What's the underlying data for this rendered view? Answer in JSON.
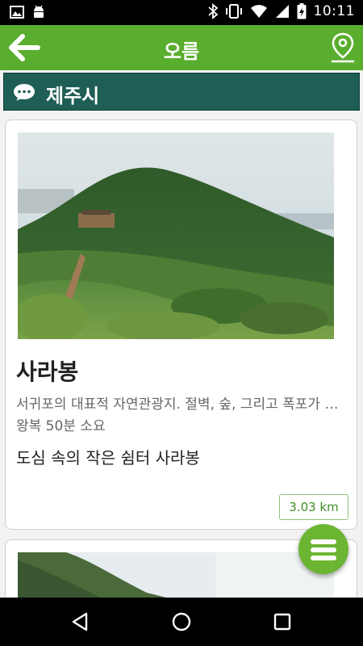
{
  "status_bar": {
    "time": "10:11",
    "icons": [
      "image-icon",
      "android-icon",
      "bluetooth-icon",
      "vibrate-icon",
      "wifi-icon",
      "signal-icon",
      "battery-charging-icon"
    ]
  },
  "app_bar": {
    "title": "오름",
    "back_icon": "arrow-left-icon",
    "map_icon": "map-pin-icon",
    "color": "#5aae2e"
  },
  "section": {
    "label": "제주시",
    "icon": "chat-bubble-icon",
    "color": "#1e5e55"
  },
  "cards": [
    {
      "name": "사라봉",
      "description": "서귀포의 대표적 자연관광지. 절벽, 숲, 그리고 폭포가 어우러진 곳",
      "duration": "왕복 50분 소요",
      "subtitle": "도심 속의 작은 쉼터 사라봉",
      "distance": "3.03 km"
    }
  ],
  "fab": {
    "icon": "menu-icon",
    "color": "#6cb533"
  },
  "nav_bar": {
    "icons": [
      "back-triangle-icon",
      "home-circle-icon",
      "recents-square-icon"
    ]
  }
}
